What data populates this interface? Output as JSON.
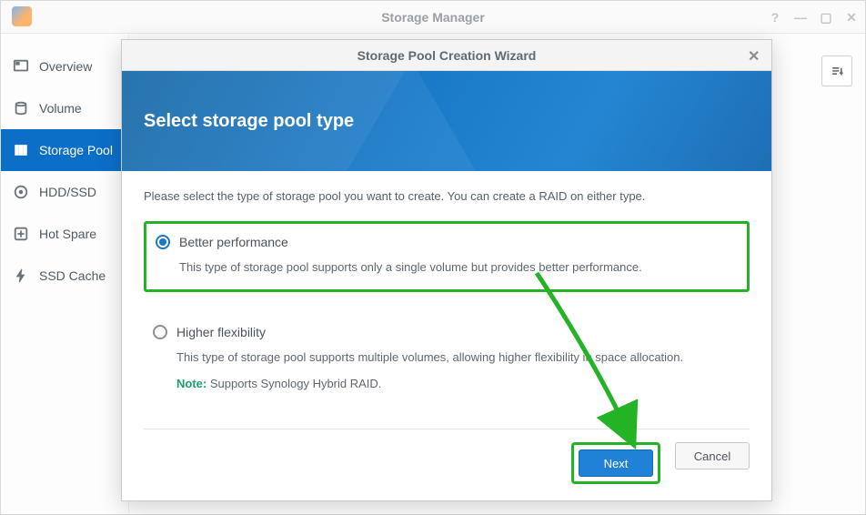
{
  "window": {
    "title": "Storage Manager"
  },
  "sidebar": {
    "items": [
      {
        "label": "Overview"
      },
      {
        "label": "Volume"
      },
      {
        "label": "Storage Pool"
      },
      {
        "label": "HDD/SSD"
      },
      {
        "label": "Hot Spare"
      },
      {
        "label": "SSD Cache"
      }
    ],
    "active_index": 2
  },
  "wizard": {
    "dialog_title": "Storage Pool Creation Wizard",
    "banner_title": "Select storage pool type",
    "intro": "Please select the type of storage pool you want to create. You can create a RAID on either type.",
    "options": [
      {
        "label": "Better performance",
        "description": "This type of storage pool supports only a single volume but provides better performance.",
        "selected": true
      },
      {
        "label": "Higher flexibility",
        "description": "This type of storage pool supports multiple volumes, allowing higher flexibility in space allocation.",
        "note_label": "Note:",
        "note_text": " Supports Synology Hybrid RAID.",
        "selected": false
      }
    ],
    "buttons": {
      "next": "Next",
      "cancel": "Cancel"
    }
  },
  "annotation": {
    "highlight_option_index": 0,
    "highlight_next_button": true,
    "arrow_color": "#24b324"
  }
}
